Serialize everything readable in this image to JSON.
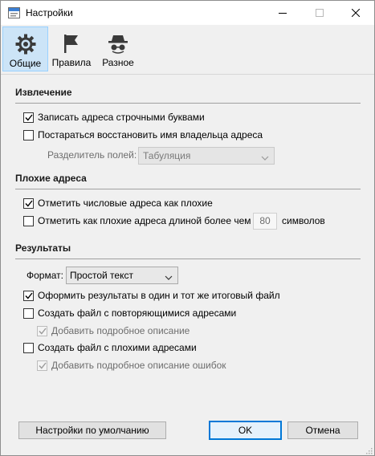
{
  "window": {
    "title": "Настройки"
  },
  "toolbar": {
    "tabs": [
      {
        "label": "Общие",
        "icon": "gear-icon",
        "active": true
      },
      {
        "label": "Правила",
        "icon": "flag-icon",
        "active": false
      },
      {
        "label": "Разное",
        "icon": "spy-icon",
        "active": false
      }
    ]
  },
  "extraction": {
    "title": "Извлечение",
    "lowercase_label": "Записать адреса строчными буквами",
    "lowercase_checked": true,
    "restore_owner_label": "Постараться восстановить имя владельца адреса",
    "restore_owner_checked": false,
    "separator_label": "Разделитель полей:",
    "separator_value": "Табуляция"
  },
  "bad": {
    "title": "Плохие адреса",
    "numeric_label": "Отметить числовые адреса как плохие",
    "numeric_checked": true,
    "length_label": "Отметить как плохие адреса длиной более чем",
    "length_checked": false,
    "length_value": "80",
    "length_unit": "символов"
  },
  "results": {
    "title": "Результаты",
    "format_label": "Формат:",
    "format_value": "Простой текст",
    "single_file_label": "Оформить результаты в один и тот же итоговый файл",
    "single_file_checked": true,
    "dup_file_label": "Создать файл с повторяющимися адресами",
    "dup_file_checked": false,
    "dup_desc_label": "Добавить подробное описание",
    "dup_desc_checked": true,
    "bad_file_label": "Создать файл с плохими адресами",
    "bad_file_checked": false,
    "bad_desc_label": "Добавить подробное описание ошибок",
    "bad_desc_checked": true
  },
  "buttons": {
    "defaults": "Настройки по умолчанию",
    "ok": "OK",
    "cancel": "Отмена"
  },
  "colors": {
    "accent": "#0078d7",
    "active_tab": "#cce4f7"
  }
}
